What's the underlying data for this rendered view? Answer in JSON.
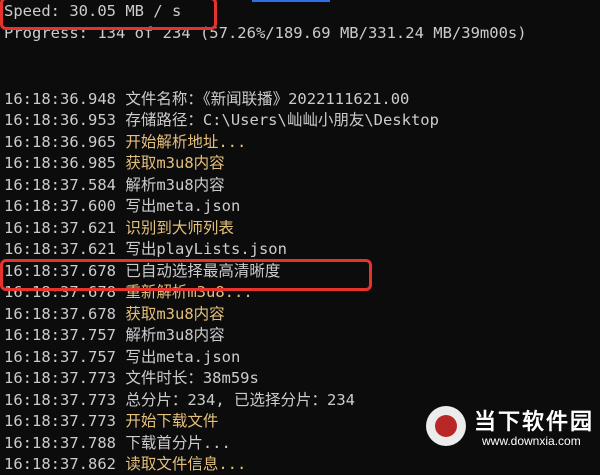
{
  "header": {
    "speed": "Speed: 30.05 MB / s",
    "progress": "Progress: 134 of 234 (57.26%/189.69 MB/331.24 MB/39m00s)"
  },
  "log": [
    {
      "time": "16:18:36.948",
      "msg": "文件名称：《新闻联播》2022111621.00",
      "color": "white"
    },
    {
      "time": "16:18:36.953",
      "msg": "存储路径：C:\\Users\\屾屾小朋友\\Desktop",
      "color": "white"
    },
    {
      "time": "16:18:36.965",
      "msg": "开始解析地址...",
      "color": "yellow"
    },
    {
      "time": "16:18:36.985",
      "msg": "获取m3u8内容",
      "color": "yellow"
    },
    {
      "time": "16:18:37.584",
      "msg": "解析m3u8内容",
      "color": "white"
    },
    {
      "time": "16:18:37.600",
      "msg": "写出meta.json",
      "color": "white"
    },
    {
      "time": "16:18:37.621",
      "msg": "识别到大师列表",
      "color": "yellow"
    },
    {
      "time": "16:18:37.621",
      "msg": "写出playLists.json",
      "color": "white"
    },
    {
      "time": "16:18:37.678",
      "msg": "已自动选择最高清晰度",
      "color": "white"
    },
    {
      "time": "16:18:37.678",
      "msg": "重新解析m3u8...",
      "color": "yellow"
    },
    {
      "time": "16:18:37.678",
      "msg": "获取m3u8内容",
      "color": "yellow"
    },
    {
      "time": "16:18:37.757",
      "msg": "解析m3u8内容",
      "color": "white"
    },
    {
      "time": "16:18:37.757",
      "msg": "写出meta.json",
      "color": "white"
    },
    {
      "time": "16:18:37.773",
      "msg": "文件时长：38m59s",
      "color": "white"
    },
    {
      "time": "16:18:37.773",
      "msg": "总分片：234, 已选择分片：234",
      "color": "white"
    },
    {
      "time": "16:18:37.773",
      "msg": "开始下载文件",
      "color": "yellow"
    },
    {
      "time": "16:18:37.788",
      "msg": "下载首分片...",
      "color": "white"
    },
    {
      "time": "16:18:37.862",
      "msg": "读取文件信息...",
      "color": "yellow"
    }
  ],
  "watermark": {
    "title": "当下软件园",
    "url": "www.downxia.com"
  },
  "colors": {
    "background": "#0c0c0c",
    "text": "#cccccc",
    "yellow": "#e5c07b",
    "highlight": "#e8332c"
  }
}
